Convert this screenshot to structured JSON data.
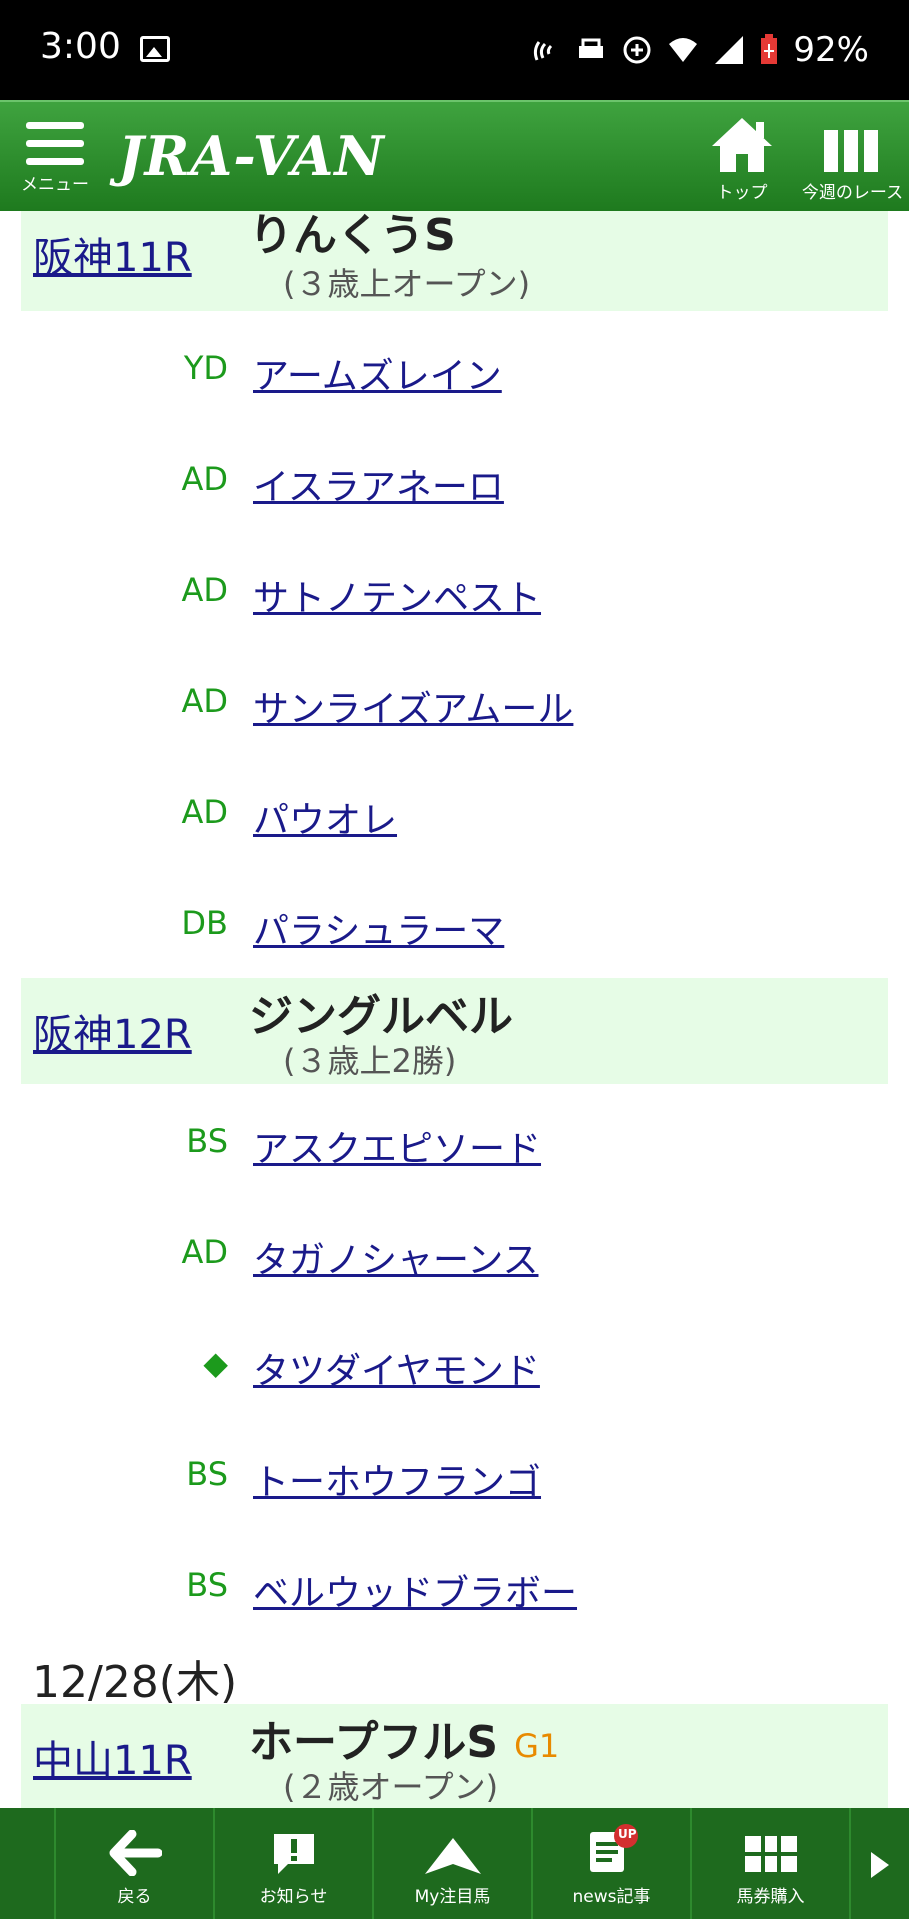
{
  "status": {
    "time": "3:00",
    "battery": "92%"
  },
  "header": {
    "menu_label": "メニュー",
    "logo": "JRA-VAN",
    "top_label": "トップ",
    "week_label": "今週のレース"
  },
  "races": [
    {
      "link": "阪神11R",
      "name": "りんくうS",
      "sub": "(３歳上オープン)",
      "grade": ""
    },
    {
      "link": "阪神12R",
      "name": "ジングルベル",
      "sub": "(３歳上2勝)",
      "grade": ""
    },
    {
      "link": "中山11R",
      "name": "ホープフルS",
      "sub": "(２歳オープン)",
      "grade": "G1"
    }
  ],
  "horses_race1": [
    {
      "mark": "YD",
      "name": "アームズレイン"
    },
    {
      "mark": "AD",
      "name": "イスラアネーロ"
    },
    {
      "mark": "AD",
      "name": "サトノテンペスト"
    },
    {
      "mark": "AD",
      "name": "サンライズアムール"
    },
    {
      "mark": "AD",
      "name": "パウオレ"
    },
    {
      "mark": "DB",
      "name": "パラシュラーマ"
    }
  ],
  "horses_race2": [
    {
      "mark": "BS",
      "name": "アスクエピソード"
    },
    {
      "mark": "AD",
      "name": "タガノシャーンス"
    },
    {
      "mark": "◆",
      "name": "タツダイヤモンド"
    },
    {
      "mark": "BS",
      "name": "トーホウフランゴ"
    },
    {
      "mark": "BS",
      "name": "ベルウッドブラボー"
    }
  ],
  "date_header": "12/28(木)",
  "bottom_nav": [
    {
      "label": "戻る"
    },
    {
      "label": "お知らせ"
    },
    {
      "label": "My注目馬"
    },
    {
      "label": "news記事",
      "badge": "UP"
    },
    {
      "label": "馬券購入"
    }
  ],
  "colors": {
    "header_green": "#2e8b2e",
    "race_bg": "#e6fce6",
    "mark_green": "#1c9a1c",
    "link_blue": "#1a1a8a",
    "grade_orange": "#e88a00"
  }
}
